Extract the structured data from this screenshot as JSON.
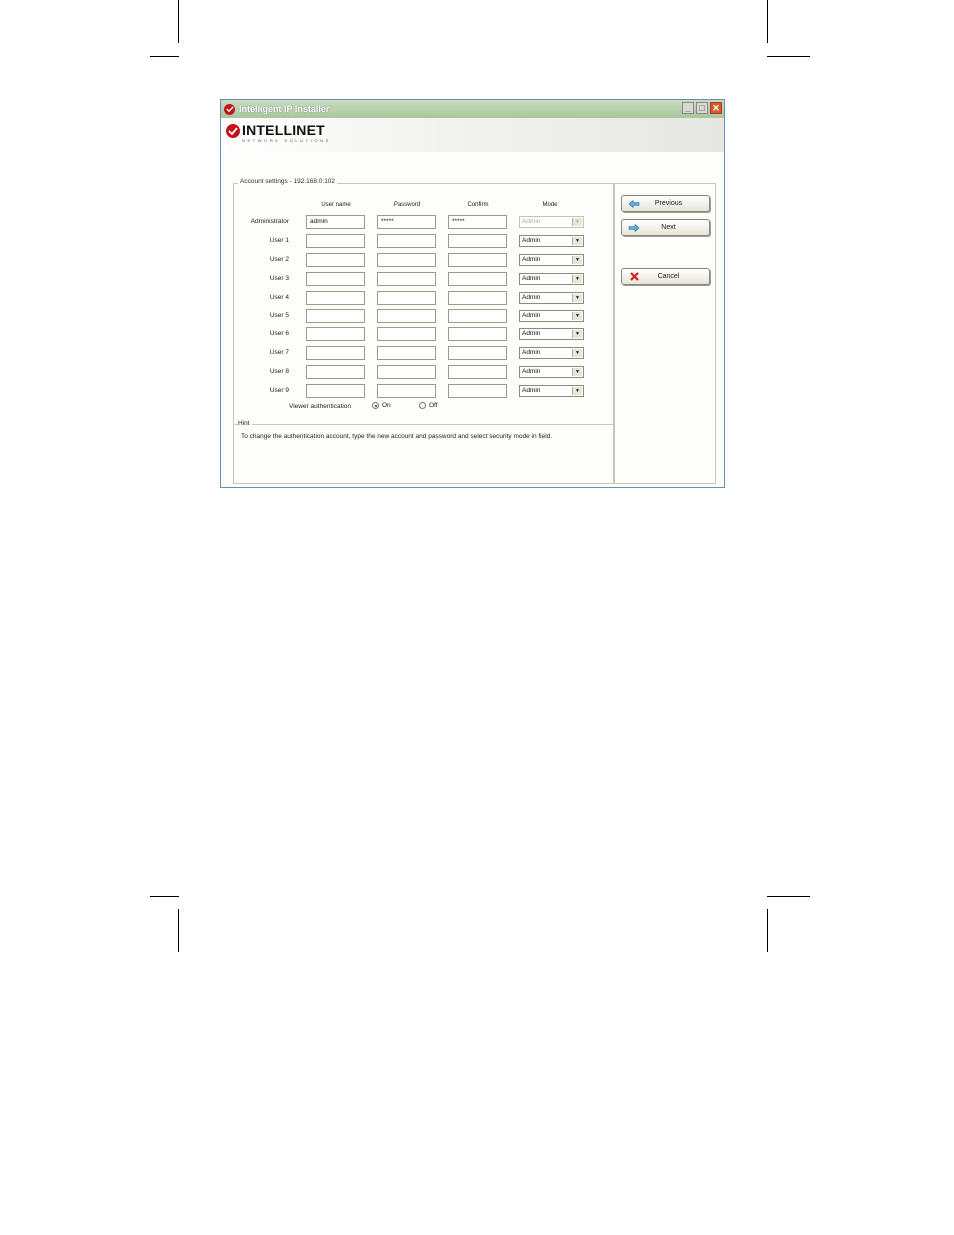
{
  "window": {
    "title": "Intelligent IP Installer",
    "controls": {
      "minimize": "_",
      "maximize": "□",
      "close": "✕"
    }
  },
  "brand": {
    "name": "INTELLINET",
    "tagline": "NETWORK SOLUTIONS"
  },
  "account_group": {
    "legend": "Account settings - 192.168.0.102"
  },
  "columns": {
    "username": "User name",
    "password": "Password",
    "confirm": "Confirm",
    "mode": "Mode"
  },
  "rows": [
    {
      "label": "Administrator",
      "username": "admin",
      "password": "*****",
      "confirm": "*****",
      "mode": "Admin",
      "mode_disabled": true
    },
    {
      "label": "User 1",
      "username": "",
      "password": "",
      "confirm": "",
      "mode": "Admin"
    },
    {
      "label": "User 2",
      "username": "",
      "password": "",
      "confirm": "",
      "mode": "Admin"
    },
    {
      "label": "User 3",
      "username": "",
      "password": "",
      "confirm": "",
      "mode": "Admin"
    },
    {
      "label": "User 4",
      "username": "",
      "password": "",
      "confirm": "",
      "mode": "Admin"
    },
    {
      "label": "User 5",
      "username": "",
      "password": "",
      "confirm": "",
      "mode": "Admin"
    },
    {
      "label": "User 6",
      "username": "",
      "password": "",
      "confirm": "",
      "mode": "Admin"
    },
    {
      "label": "User 7",
      "username": "",
      "password": "",
      "confirm": "",
      "mode": "Admin"
    },
    {
      "label": "User 8",
      "username": "",
      "password": "",
      "confirm": "",
      "mode": "Admin"
    },
    {
      "label": "User 9",
      "username": "",
      "password": "",
      "confirm": "",
      "mode": "Admin"
    }
  ],
  "viewer_auth": {
    "label": "Viewer authentication",
    "on_label": "On",
    "off_label": "Off",
    "selected": "On"
  },
  "hint": {
    "title": "Hint",
    "text": "To change the authentication account, type the new account and password and select security mode in field."
  },
  "buttons": {
    "previous": {
      "label": "Previous",
      "icon": "arrow-left-icon",
      "color": "#3a8fd0"
    },
    "next": {
      "label": "Next",
      "icon": "arrow-right-icon",
      "color": "#3a8fd0"
    },
    "cancel": {
      "label": "Cancel",
      "icon": "red-x-icon",
      "color": "#d42020"
    }
  },
  "colors": {
    "brand_red": "#c0161b",
    "titlebar": "#a8c79a",
    "window_bg": "#ece9d8"
  }
}
